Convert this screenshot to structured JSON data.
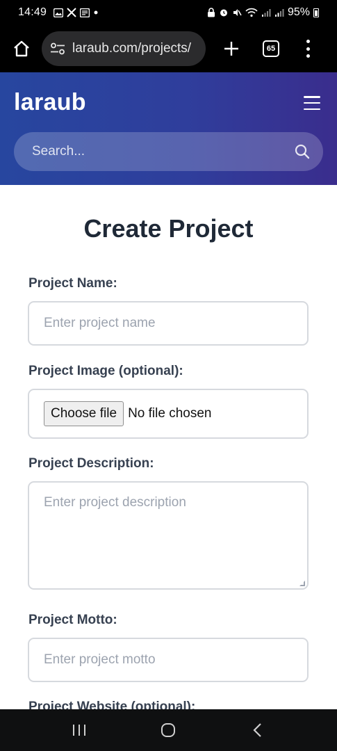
{
  "status_bar": {
    "time": "14:49",
    "battery": "95%",
    "left_icons": [
      "gallery-icon",
      "x-icon",
      "news-icon",
      "dot-icon"
    ],
    "right_icons": [
      "lock-icon",
      "alarm-icon",
      "mute-icon",
      "wifi-icon",
      "signal-icon",
      "signal-icon",
      "battery-icon"
    ]
  },
  "browser": {
    "url": "laraub.com/projects/",
    "tab_count": "65"
  },
  "site": {
    "brand": "laraub",
    "search_placeholder": "Search..."
  },
  "form": {
    "title": "Create Project",
    "name_label": "Project Name:",
    "name_placeholder": "Enter project name",
    "image_label": "Project Image (optional):",
    "file_button": "Choose file",
    "file_status": "No file chosen",
    "description_label": "Project Description:",
    "description_placeholder": "Enter project description",
    "motto_label": "Project Motto:",
    "motto_placeholder": "Enter project motto",
    "website_label": "Project Website (optional):"
  },
  "colors": {
    "header_start": "#27469f",
    "header_end": "#3a2d8d",
    "title_text": "#1f2937",
    "label_text": "#374151",
    "border": "#d6d9de"
  }
}
